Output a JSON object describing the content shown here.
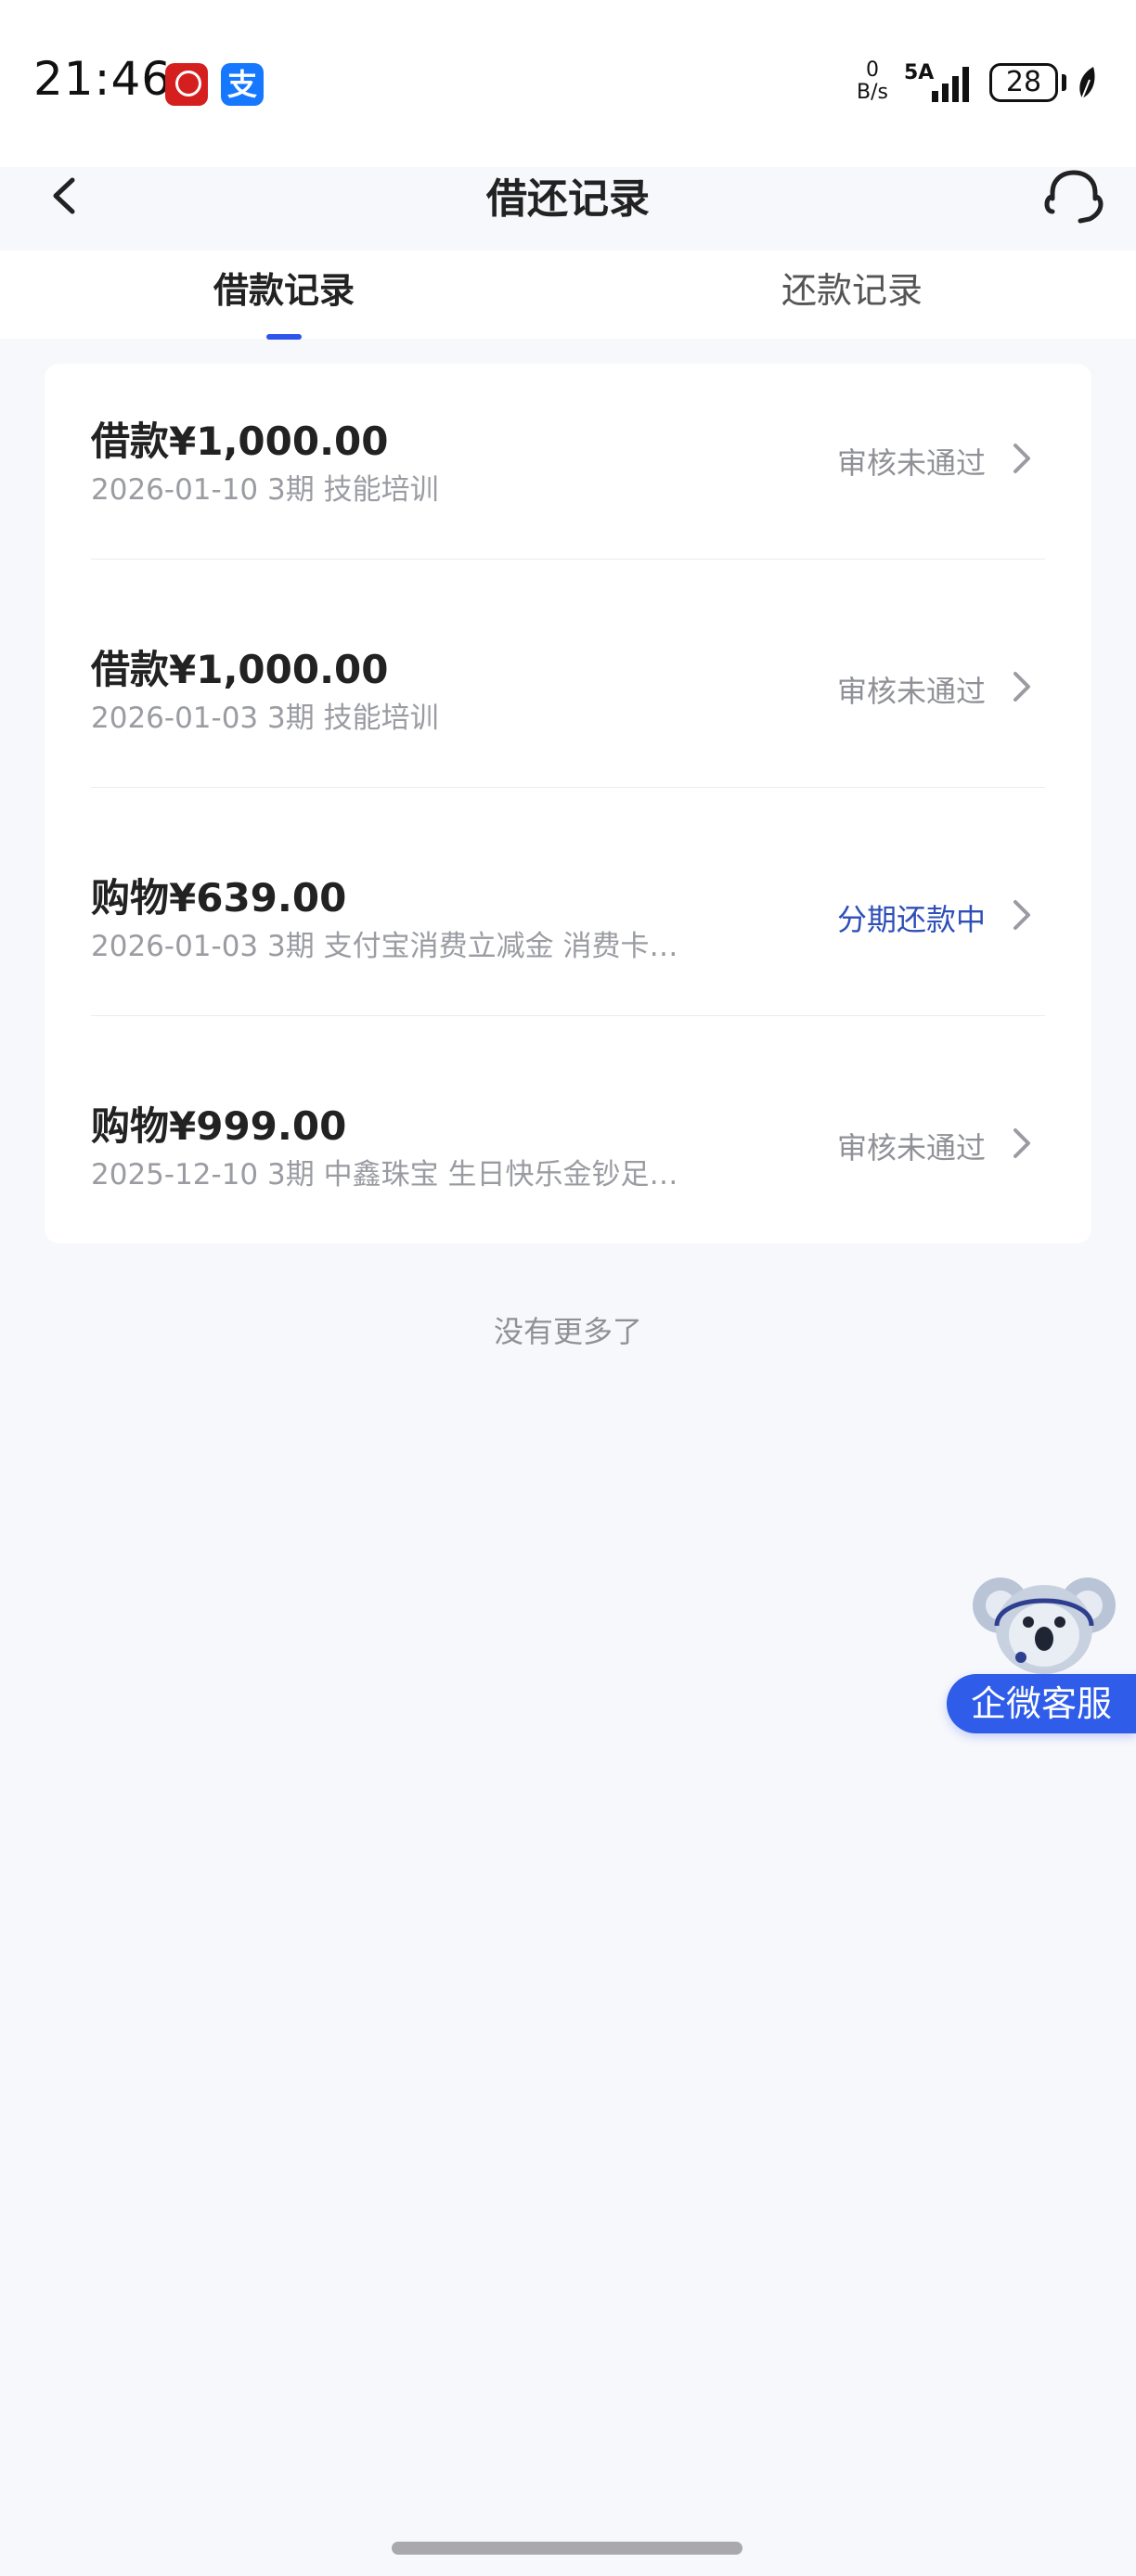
{
  "status_bar": {
    "time": "21:46",
    "alipay_glyph": "支",
    "net_speed_top": "0",
    "net_speed_bottom": "B/s",
    "network": "5A",
    "battery": "28"
  },
  "header": {
    "title": "借还记录"
  },
  "tabs": [
    {
      "label": "借款记录",
      "active": true
    },
    {
      "label": "还款记录",
      "active": false
    }
  ],
  "records": [
    {
      "title": "借款¥1,000.00",
      "sub": "2026-01-10 3期  技能培训",
      "status": "审核未通过"
    },
    {
      "title": "借款¥1,000.00",
      "sub": "2026-01-03 3期  技能培训",
      "status": "审核未通过"
    },
    {
      "title": "购物¥639.00",
      "sub": "2026-01-03 3期  支付宝消费立减金 消费卡…",
      "status": "分期还款中"
    },
    {
      "title": "购物¥999.00",
      "sub": "2025-12-10 3期  中鑫珠宝 生日快乐金钞足…",
      "status": "审核未通过"
    }
  ],
  "footer": {
    "no_more": "没有更多了"
  },
  "customer_service": {
    "label": "企微客服"
  },
  "colors": {
    "accent": "#2f54eb",
    "status_blue": "#2f4fb8",
    "status_gray": "#8f9196",
    "badge": "#2f5ce8"
  },
  "icons": [
    "back-arrow-icon",
    "headset-icon",
    "chevron-right-icon",
    "koala-mascot-icon",
    "signal-icon",
    "battery-icon",
    "leaf-icon"
  ]
}
